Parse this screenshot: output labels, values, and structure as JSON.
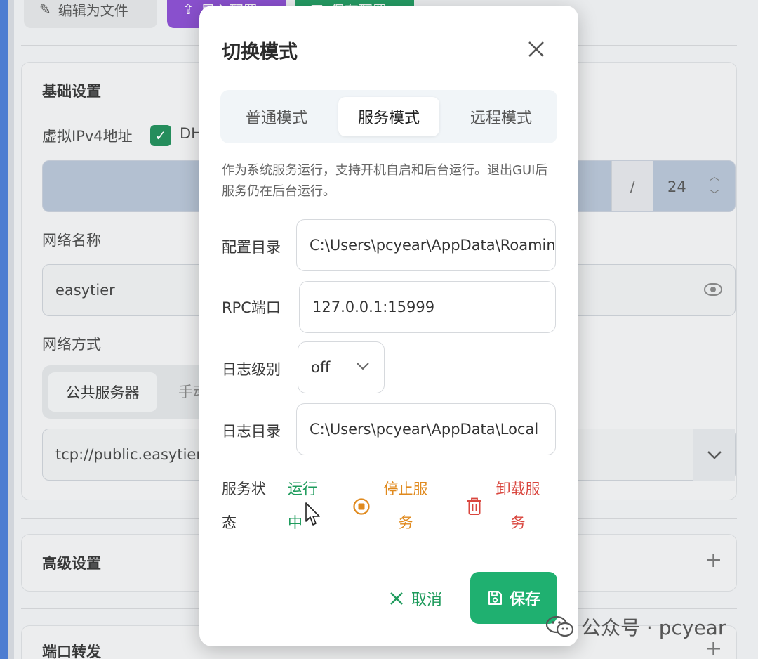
{
  "background": {
    "top_buttons": {
      "edit_file": "编辑为文件",
      "import": "导入配置",
      "save_config": "保存配置"
    },
    "basic_settings": {
      "title": "基础设置",
      "virtual_ip_label": "虚拟IPv4地址",
      "dhcp_label": "DH",
      "ip_prefix": "24",
      "slash": "/",
      "network_name_label": "网络名称",
      "network_name_value": "easytier",
      "network_mode_label": "网络方式",
      "mode_public": "公共服务器",
      "mode_manual": "手动",
      "server_value": "tcp://public.easytier"
    },
    "advanced_settings_title": "高级设置",
    "port_forward_title": "端口转发"
  },
  "modal": {
    "title": "切换模式",
    "tabs": [
      {
        "label": "普通模式"
      },
      {
        "label": "服务模式"
      },
      {
        "label": "远程模式"
      }
    ],
    "active_tab": "服务模式",
    "description": "作为系统服务运行，支持开机自启和后台运行。退出GUI后服务仍在后台运行。",
    "fields": {
      "config_dir_label": "配置目录",
      "config_dir_value": "C:\\Users\\pcyear\\AppData\\Roaming",
      "rpc_port_label": "RPC端口",
      "rpc_port_value": "127.0.0.1:15999",
      "log_level_label": "日志级别",
      "log_level_value": "off",
      "log_dir_label": "日志目录",
      "log_dir_value": "C:\\Users\\pcyear\\AppData\\Local"
    },
    "service_status": {
      "label": "服务状态",
      "status_text": "运行中",
      "stop_label": "停止服务",
      "uninstall_label": "卸载服务"
    },
    "cancel_label": "取消",
    "save_label": "保存"
  },
  "watermark": {
    "text": "公众号 · pcyear"
  },
  "colors": {
    "accent_green": "#1fb070",
    "running_green": "#1e9b5c",
    "stop_orange": "#e08a1e",
    "uninstall_red": "#d9463e"
  }
}
